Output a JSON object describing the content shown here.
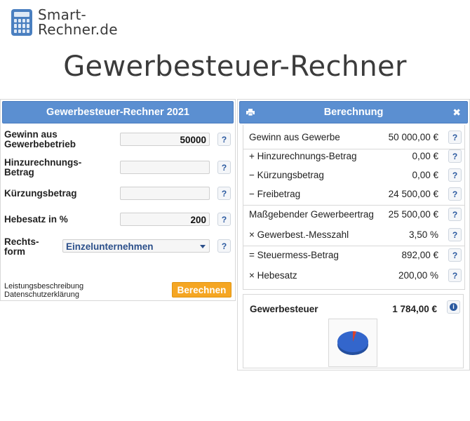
{
  "logo": {
    "line1": "Smart-",
    "line2": "Rechner.de"
  },
  "page_title": "Gewerbesteuer-Rechner",
  "calculator": {
    "title": "Gewerbesteuer-Rechner 2021",
    "fields": {
      "gewinn": {
        "label1": "Gewinn aus",
        "label2": "Gewerbebetrieb",
        "value": "50000"
      },
      "hinzurechnung": {
        "label1": "Hinzurechnungs-",
        "label2": "Betrag",
        "value": ""
      },
      "kuerzung": {
        "label": "Kürzungsbetrag",
        "value": ""
      },
      "hebesatz": {
        "label": "Hebesatz in %",
        "value": "200"
      },
      "rechtsform": {
        "label1": "Rechts-",
        "label2": "form",
        "selected": "Einzelunternehmen"
      }
    },
    "help": "?",
    "link1": "Leistungsbeschreibung",
    "link2": "Datenschutzerklärung",
    "submit": "Berechnen"
  },
  "result": {
    "title": "Berechnung",
    "close": "✖",
    "rows": [
      {
        "label": "Gewinn aus Gewerbe",
        "value": "50 000,00 €"
      },
      {
        "label": "+ Hinzurechnungs-Betrag",
        "value": "0,00 €"
      },
      {
        "label": "− Kürzungsbetrag",
        "value": "0,00 €"
      },
      {
        "label": "− Freibetrag",
        "value": "24 500,00 €"
      },
      {
        "label": "Maßgebender Gewerbeertrag",
        "value": "25 500,00 €"
      },
      {
        "label": "× Gewerbest.-Messzahl",
        "value": "3,50 %"
      },
      {
        "label": "= Steuermess-Betrag",
        "value": "892,00 €"
      },
      {
        "label": "× Hebesatz",
        "value": "200,00 %"
      }
    ],
    "total_label": "Gewerbesteuer",
    "total_value": "1 784,00 €",
    "info": "i",
    "pie": {
      "tax_share": 0.036,
      "tax_color": "#d9412b",
      "rest_color": "#3366cc"
    }
  }
}
